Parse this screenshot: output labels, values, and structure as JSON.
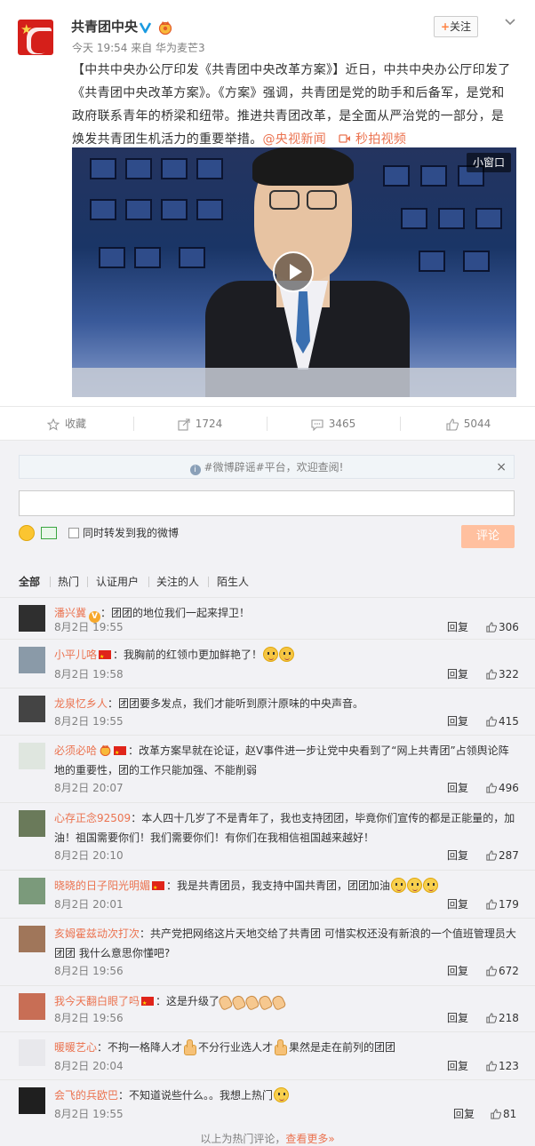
{
  "post": {
    "username": "共青团中央",
    "meta": "今天 19:54 来自 华为麦芒3",
    "follow_label": "关注",
    "text_part1": "【中共中央办公厅印发《共青团中央改革方案》】近日，中共中央办公厅印发了《共青团中央改革方案》。《方案》强调，共青团是党的助手和后备军，是党和政府联系青年的桥梁和纽带。推进共青团改革，是全面从严治党的一部分，是焕发共青团生机活力的重要举措。",
    "at_link": "@央视新闻",
    "video_link": "秒拍视频",
    "mini_window": "小窗口"
  },
  "actions": {
    "favorite": "收藏",
    "repost": "1724",
    "comment": "3465",
    "like": "5044"
  },
  "compose": {
    "notice": "#微博辟谣#平台，欢迎查阅!",
    "notice_close": "×",
    "repost_label": "同时转发到我的微博",
    "submit": "评论"
  },
  "filters": [
    "全部",
    "热门",
    "认证用户",
    "关注的人",
    "陌生人"
  ],
  "comments": [
    {
      "name": "潘兴冀",
      "text": "：团团的地位我们一起来捍卫！",
      "time": "8月2日 19:55",
      "likes": "306"
    },
    {
      "name": "小平儿咯",
      "text": "：我胸前的红领巾更加鲜艳了！",
      "time": "8月2日 19:58",
      "likes": "322"
    },
    {
      "name": "龙泉忆乡人",
      "text": "：团团要多发点，我们才能听到原汁原味的中央声音。",
      "time": "8月2日 19:55",
      "likes": "415"
    },
    {
      "name": "必须必哈",
      "text": "：改革方案早就在论证，赵V事件进一步让党中央看到了“网上共青团”占领舆论阵地的重要性，团的工作只能加强、不能削弱",
      "time": "8月2日 20:07",
      "likes": "496"
    },
    {
      "name": "心存正念92509",
      "text": "：本人四十几岁了不是青年了，我也支持团团，毕竟你们宣传的都是正能量的，加油！祖国需要你们！我们需要你们！有你们在我相信祖国越来越好！",
      "time": "8月2日 20:10",
      "likes": "287"
    },
    {
      "name": "晓晓的日子阳光明媚",
      "text": "：我是共青团员，我支持中国共青团，团团加油",
      "time": "8月2日 20:01",
      "likes": "179"
    },
    {
      "name": "亥姆霍兹动次打次",
      "text": "：共产党把网络这片天地交给了共青团 可惜实权还没有新浪的一个值班管理员大团团 我什么意思你懂吧?",
      "time": "8月2日 19:56",
      "likes": "672"
    },
    {
      "name": "我今天翻白眼了吗",
      "text": "：这是升级了",
      "time": "8月2日 19:56",
      "likes": "218"
    },
    {
      "name": "暖暖艺心",
      "text_a": "：不拘一格降人才",
      "text_b": "不分行业选人才",
      "text_c": "果然是走在前列的团团",
      "time": "8月2日 20:04",
      "likes": "123"
    },
    {
      "name": "会飞的兵欧巴",
      "text": "：不知道说些什么。。我想上热门",
      "time": "8月2日 19:55",
      "likes": "81"
    }
  ],
  "reply_label": "回复",
  "footer": {
    "text": "以上为热门评论，",
    "link": "查看更多»"
  },
  "colors": {
    "accent": "#eb7350",
    "link": "#eb7350",
    "submit_disabled": "#ffc09f"
  }
}
